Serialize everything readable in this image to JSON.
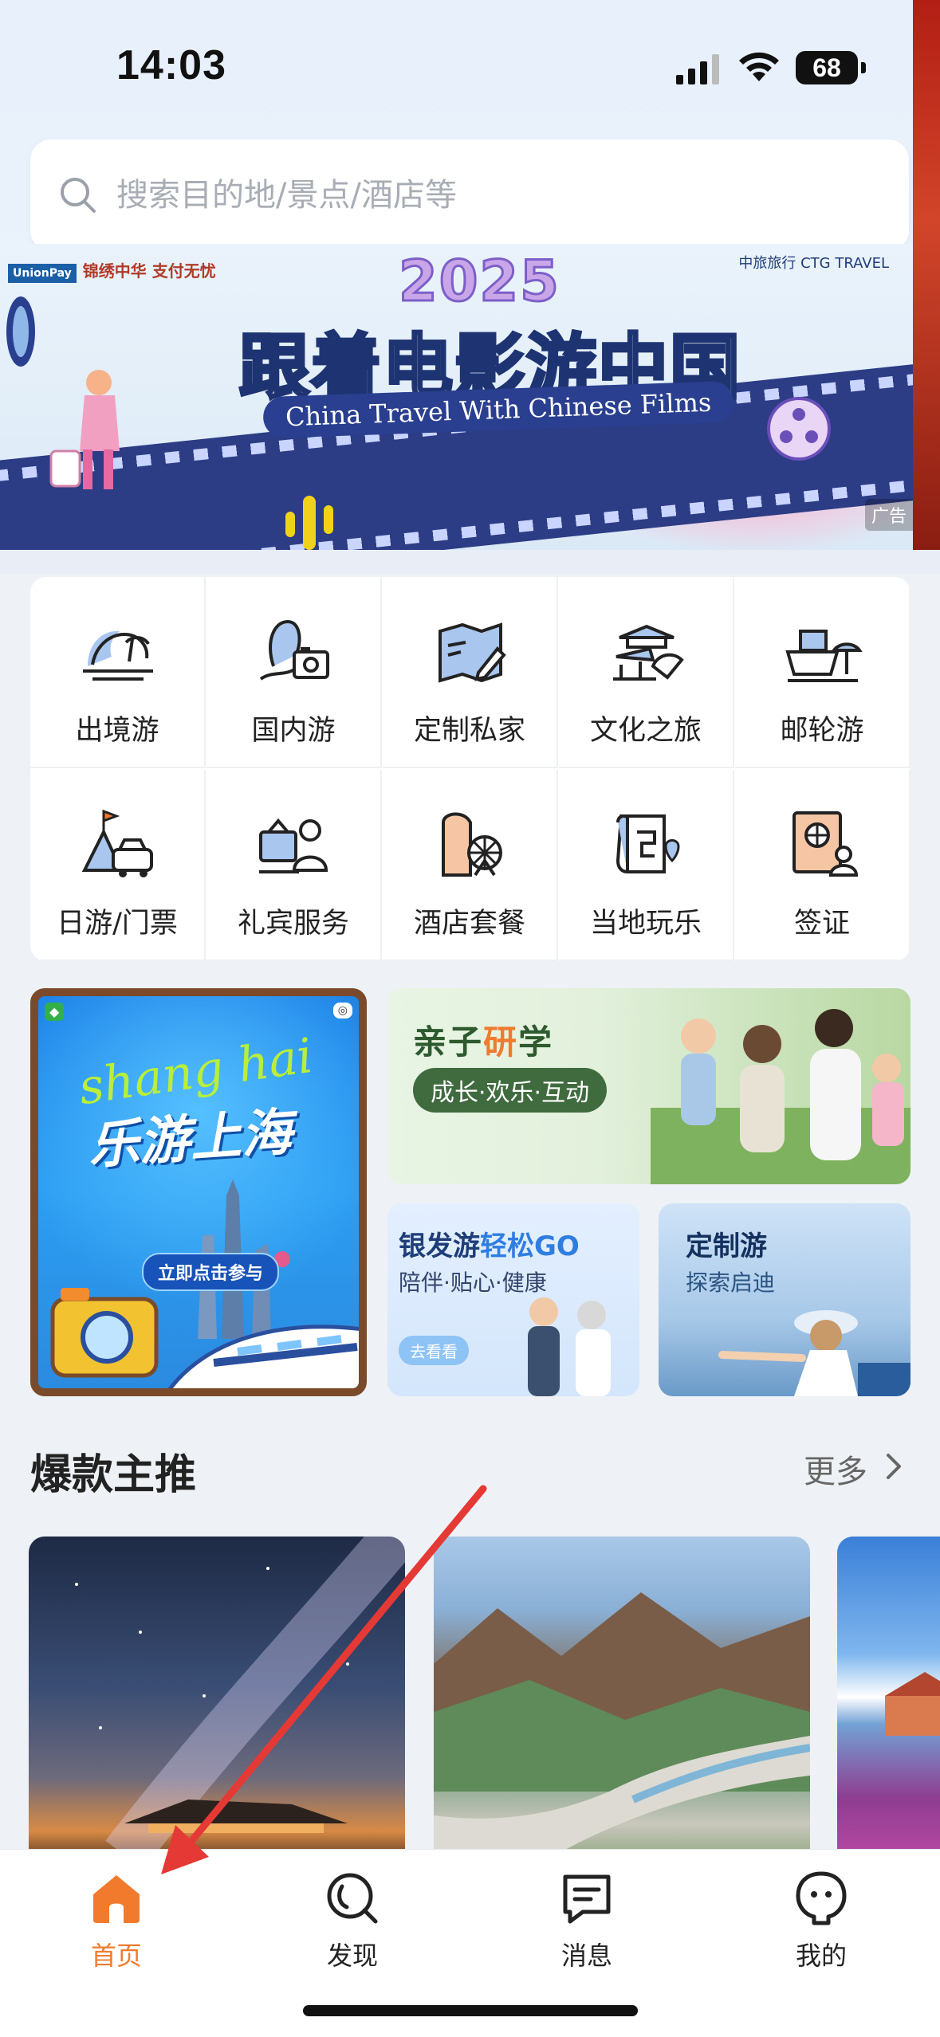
{
  "status_bar": {
    "time": "14:03",
    "battery": "68"
  },
  "search": {
    "placeholder": "搜索目的地/景点/酒店等"
  },
  "banner": {
    "year": "2025",
    "title": "跟着电影游中国",
    "subtitle": "China Travel With Chinese Films",
    "left_text": "锦绣中华 支付无忧",
    "pay_label": "UnionPay",
    "brand": "中旅旅行 CTG TRAVEL",
    "ad_label": "广告"
  },
  "grid": {
    "items": [
      {
        "label": "出境游",
        "icon": "outbound-travel-icon"
      },
      {
        "label": "国内游",
        "icon": "domestic-travel-icon"
      },
      {
        "label": "定制私家",
        "icon": "custom-private-icon"
      },
      {
        "label": "文化之旅",
        "icon": "culture-tour-icon"
      },
      {
        "label": "邮轮游",
        "icon": "cruise-icon"
      },
      {
        "label": "日游/门票",
        "icon": "day-tour-ticket-icon"
      },
      {
        "label": "礼宾服务",
        "icon": "concierge-icon"
      },
      {
        "label": "酒店套餐",
        "icon": "hotel-package-icon"
      },
      {
        "label": "当地玩乐",
        "icon": "local-fun-icon"
      },
      {
        "label": "签证",
        "icon": "visa-icon"
      }
    ]
  },
  "promos": {
    "shanghai": {
      "title_en": "shang hai",
      "title": "乐游上海",
      "button": "立即点击参与"
    },
    "family": {
      "title_main": "亲子",
      "title_accent": "研",
      "title_end": "学",
      "tag": "成长·欢乐·互动"
    },
    "silver": {
      "title_main": "银发游",
      "title_accent": "轻松GO",
      "subtitle": "陪伴·贴心·健康",
      "button": "去看看"
    },
    "custom": {
      "title": "定制游",
      "subtitle": "探索启迪"
    }
  },
  "section": {
    "title": "爆款主推",
    "more": "更多"
  },
  "tabs": [
    {
      "label": "首页",
      "icon": "home-icon",
      "active": true
    },
    {
      "label": "发现",
      "icon": "discover-icon",
      "active": false
    },
    {
      "label": "消息",
      "icon": "message-icon",
      "active": false
    },
    {
      "label": "我的",
      "icon": "profile-icon",
      "active": false
    }
  ],
  "colors": {
    "accent": "#f27a2c",
    "text": "#222222",
    "placeholder": "#a8adb5",
    "annotation": "#e53935"
  }
}
